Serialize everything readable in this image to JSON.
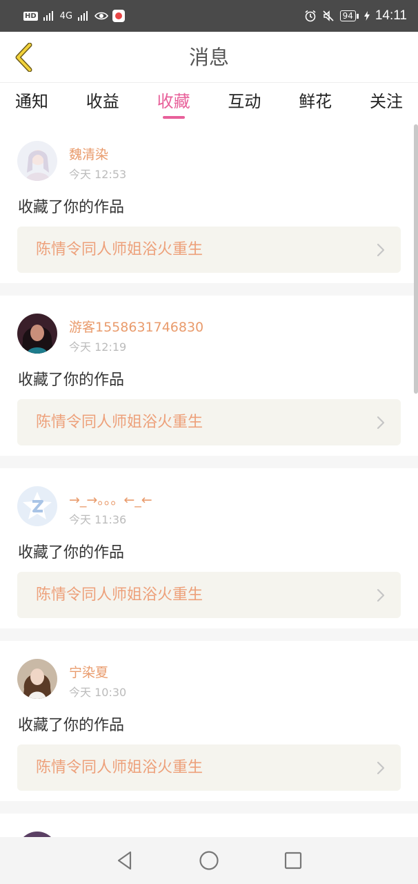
{
  "status_bar": {
    "hd": "HD",
    "network": "4G",
    "battery": "94",
    "time": "14:11"
  },
  "header": {
    "title": "消息",
    "back_icon": "chevron-left-icon",
    "accent_color": "#e8609a"
  },
  "tabs": [
    {
      "label": "通知",
      "active": false
    },
    {
      "label": "收益",
      "active": false
    },
    {
      "label": "收藏",
      "active": true
    },
    {
      "label": "互动",
      "active": false
    },
    {
      "label": "鲜花",
      "active": false
    },
    {
      "label": "关注",
      "active": false
    }
  ],
  "messages": [
    {
      "user": "魏清染",
      "time": "今天 12:53",
      "action": "收藏了你的作品",
      "work": "陈情令同人师姐浴火重生"
    },
    {
      "user": "游客1558631746830",
      "time": "今天 12:19",
      "action": "收藏了你的作品",
      "work": "陈情令同人师姐浴火重生"
    },
    {
      "user": "→_→。。。←_←",
      "time": "今天 11:36",
      "action": "收藏了你的作品",
      "work": "陈情令同人师姐浴火重生"
    },
    {
      "user": "宁染夏",
      "time": "今天 10:30",
      "action": "收藏了你的作品",
      "work": "陈情令同人师姐浴火重生"
    }
  ],
  "colors": {
    "username": "#e99b6c",
    "work_title": "#eda07a",
    "work_bg": "#f5f4ee"
  }
}
